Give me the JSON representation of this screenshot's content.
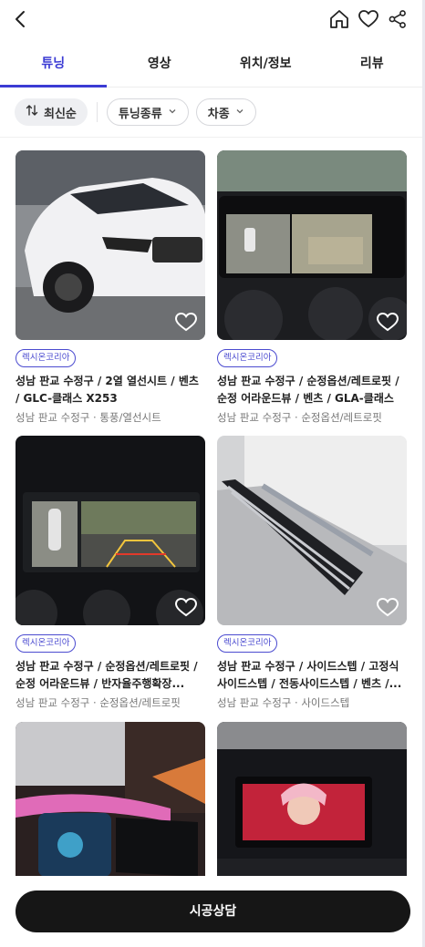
{
  "header": {
    "back_icon": "chevron-left-icon",
    "icons": [
      "home-icon",
      "heart-icon",
      "share-icon"
    ]
  },
  "tabs": [
    {
      "label": "튜닝",
      "active": true
    },
    {
      "label": "영상",
      "active": false
    },
    {
      "label": "위치/정보",
      "active": false
    },
    {
      "label": "리뷰",
      "active": false
    }
  ],
  "filters": {
    "sort_label": "최신순",
    "tuning_type_label": "튜닝종류",
    "car_type_label": "차종"
  },
  "cards": [
    {
      "badge": "렉시온코리아",
      "title": "성남 판교 수정구 / 2열 열선시트 / 벤츠 / GLC-클래스 X253",
      "subtitle": "성남 판교 수정구 · 통풍/열선시트"
    },
    {
      "badge": "렉시온코리아",
      "title": "성남 판교 수정구 / 순정옵션/레트로핏 / 순정 어라운드뷰 / 벤츠 / GLA-클래스",
      "subtitle": "성남 판교 수정구 · 순정옵션/레트로핏"
    },
    {
      "badge": "렉시온코리아",
      "title": "성남 판교 수정구 / 순정옵션/레트로핏 / 순정 어라운드뷰 / 반자율주행확장...",
      "subtitle": "성남 판교 수정구 · 순정옵션/레트로핏"
    },
    {
      "badge": "렉시온코리아",
      "title": "성남 판교 수정구 / 사이드스텝 / 고정식 사이드스텝 / 전동사이드스텝 / 벤츠 /...",
      "subtitle": "성남 판교 수정구 · 사이드스텝"
    },
    {
      "badge": "",
      "title": "",
      "subtitle": ""
    },
    {
      "badge": "",
      "title": "",
      "subtitle": ""
    }
  ],
  "cta": {
    "label": "시공상담"
  },
  "colors": {
    "accent": "#3b3bd4",
    "cta_bg": "#161616"
  }
}
